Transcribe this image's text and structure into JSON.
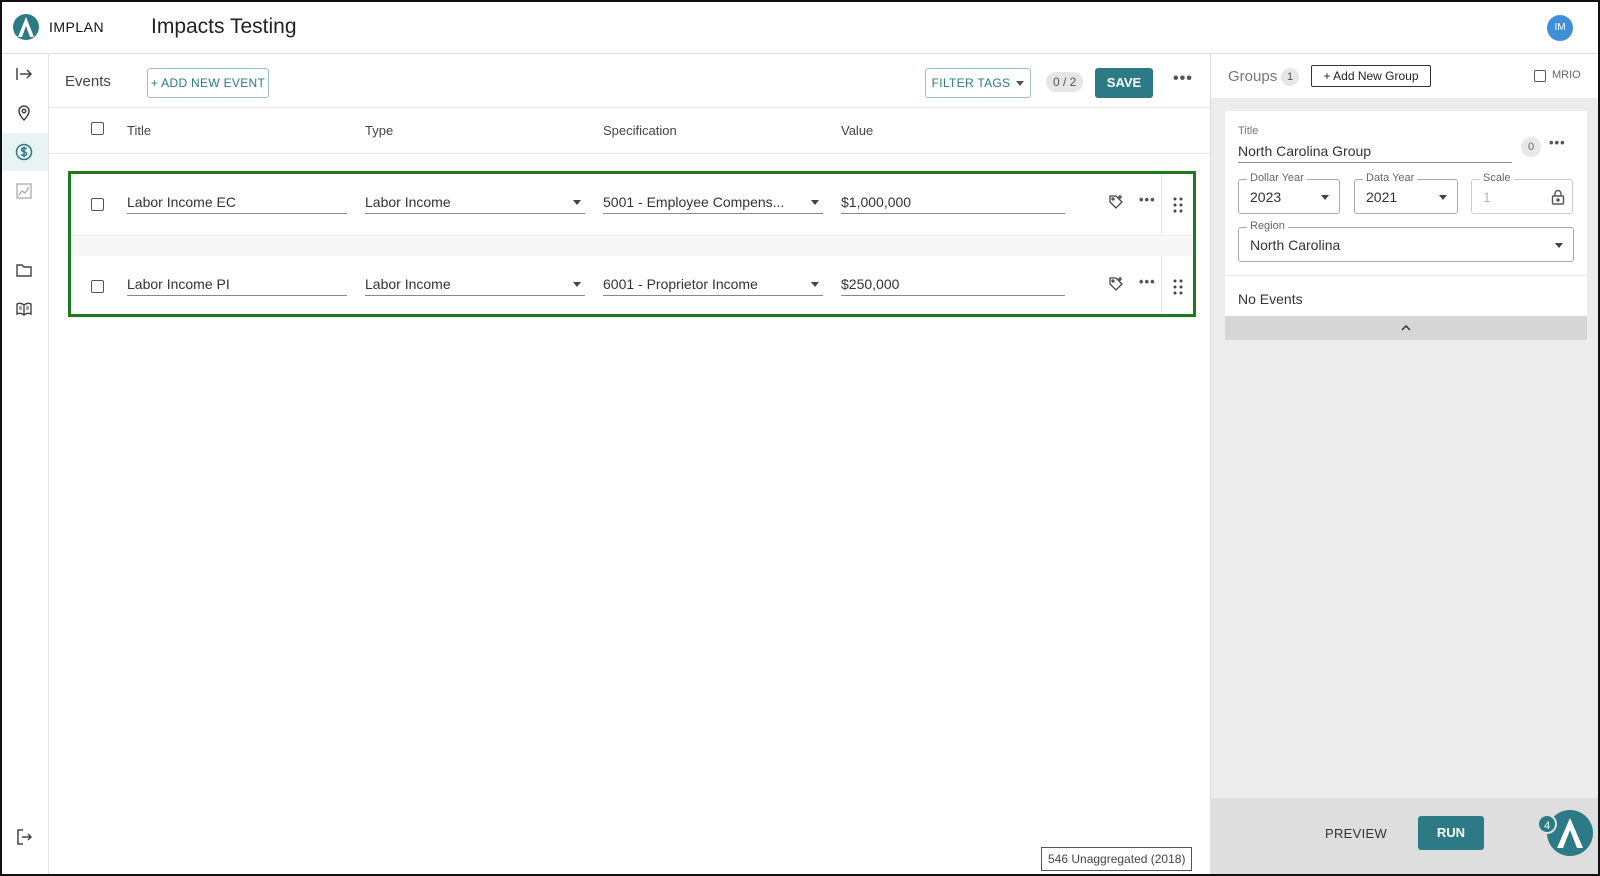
{
  "app": {
    "brand": "IMPLAN",
    "page_title": "Impacts Testing",
    "avatar_initials": "IM",
    "accent_color": "#2b7a85"
  },
  "rail": {
    "items": [
      {
        "name": "expand-icon"
      },
      {
        "name": "location-icon"
      },
      {
        "name": "dollar-icon",
        "active": true
      },
      {
        "name": "chart-icon"
      },
      {
        "name": "folder-icon"
      },
      {
        "name": "book-icon"
      },
      {
        "name": "logout-icon"
      }
    ]
  },
  "events": {
    "label": "Events",
    "count": "2",
    "add_label": "+ ADD NEW EVENT",
    "filter_label": "FILTER TAGS",
    "counter": "0 / 2",
    "save_label": "SAVE",
    "more": "•••",
    "columns": [
      "Title",
      "Type",
      "Specification",
      "Value"
    ],
    "rows": [
      {
        "title": "Labor Income EC",
        "type": "Labor Income",
        "spec": "5001 - Employee Compens...",
        "value": "$1,000,000"
      },
      {
        "title": "Labor Income PI",
        "type": "Labor Income",
        "spec": "6001 - Proprietor Income",
        "value": "$250,000"
      }
    ],
    "footer_note": "546 Unaggregated (2018)"
  },
  "groups": {
    "label": "Groups",
    "count": "1",
    "add_label": "+ Add New Group",
    "mrio_label": "MRIO",
    "card": {
      "title_label": "Title",
      "title": "North Carolina Group",
      "event_count": "0",
      "more": "•••",
      "dollar_year_label": "Dollar Year",
      "dollar_year": "2023",
      "data_year_label": "Data Year",
      "data_year": "2021",
      "scale_label": "Scale",
      "scale_placeholder": "1",
      "region_label": "Region",
      "region": "North Carolina",
      "no_events": "No Events"
    },
    "preview_label": "PREVIEW",
    "run_label": "RUN",
    "assistant_badge": "4"
  }
}
